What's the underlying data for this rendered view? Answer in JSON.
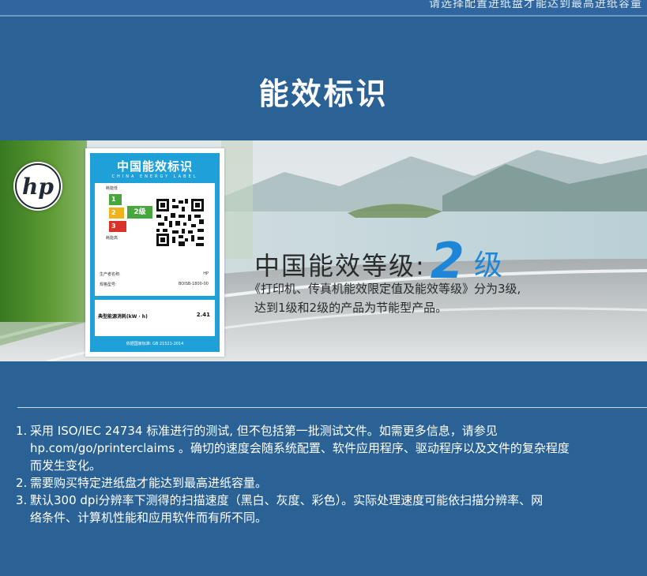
{
  "header": {
    "top_strip_text": "请选择配置进纸盘才能达到最高进纸容量"
  },
  "page_title": "能效标识",
  "brand_logo": "hp",
  "energy_label": {
    "title": "中国能效标识",
    "subtitle": "CHINA ENERGY LABEL",
    "low_consumption": "耗能低",
    "high_consumption": "耗能高",
    "grade_numbers": [
      "1",
      "2",
      "3"
    ],
    "current_grade_badge": "2级",
    "manufacturer_label": "生产者名称:",
    "manufacturer_value": "HP",
    "model_label": "规格型号:",
    "model_value": "BOISB-1800-00",
    "consumption_label": "典型能源消耗(kW · h)",
    "consumption_value": "2.41",
    "footer": "依据国家标准: GB 21521-2014",
    "colors": {
      "grade1": "#47a63e",
      "grade2": "#f2b21b",
      "grade3": "#d9322b",
      "frame": "#1fa0d8"
    }
  },
  "grade": {
    "prefix": "中国能效等级:",
    "number": "2",
    "unit": "级",
    "accent_color": "#1e86d6"
  },
  "description": {
    "line1": "《打印机、传真机能效限定值及能效等级》分为3级,",
    "line2": "达到1级和2级的产品为节能型产品。"
  },
  "notes": [
    {
      "num": "1.",
      "lines": [
        "采用 ISO/IEC 24734 标准进行的测试, 但不包括第一批测试文件。如需更多信息，请参见",
        "hp.com/go/printerclaims 。确切的速度会随系统配置、软件应用程序、驱动程序以及文件的复杂程度",
        "而发生变化。"
      ]
    },
    {
      "num": "2.",
      "lines": [
        "需要购买特定进纸盘才能达到最高进纸容量。"
      ]
    },
    {
      "num": "3.",
      "lines": [
        "默认300 dpi分辨率下测得的扫描速度（黑白、灰度、彩色）。实际处理速度可能依扫描分辨率、网",
        "络条件、计算机性能和应用软件而有所不同。"
      ]
    }
  ]
}
